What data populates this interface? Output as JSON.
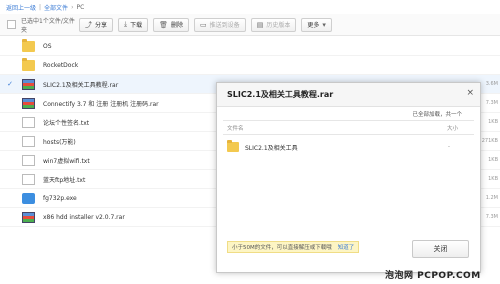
{
  "breadcrumb": {
    "items": [
      "返回上一级",
      "全部文件"
    ],
    "separator": "|",
    "current": "PC"
  },
  "toolbar": {
    "selection_text": "已选中1个文件/文件夹",
    "share_label": "分享",
    "download_label": "下载",
    "delete_label": "删除",
    "push_label": "推送到设备",
    "history_label": "历史版本",
    "more_label": "更多"
  },
  "files": [
    {
      "name": "OS",
      "type": "folder",
      "size": "",
      "selected": false
    },
    {
      "name": "RocketDock",
      "type": "folder",
      "size": "",
      "selected": false
    },
    {
      "name": "SLIC2.1及相关工具教程.rar",
      "type": "rar",
      "size": "3.6M",
      "selected": true
    },
    {
      "name": "Connectify 3.7 和 注册 注册机 注册码.rar",
      "type": "rar",
      "size": "7.3M",
      "selected": false
    },
    {
      "name": "论坛个性签名.txt",
      "type": "txt",
      "size": "1KB",
      "selected": false
    },
    {
      "name": "hosts(万能)",
      "type": "txt",
      "size": "271KB",
      "selected": false
    },
    {
      "name": "win7虚拟wifi.txt",
      "type": "txt",
      "size": "1KB",
      "selected": false
    },
    {
      "name": "蓝天ftp地址.txt",
      "type": "txt",
      "size": "1KB",
      "selected": false
    },
    {
      "name": "fg732p.exe",
      "type": "exe",
      "size": "1.2M",
      "selected": false
    },
    {
      "name": "x86 hdd installer v2.0.7.rar",
      "type": "rar",
      "size": "7.3M",
      "selected": false
    }
  ],
  "dialog": {
    "title": "SLIC2.1及相关工具教程.rar",
    "close_glyph": "×",
    "status": "已全部加载，共一个",
    "col_name": "文件名",
    "col_size": "大小",
    "entry_name": "SLIC2.1及相关工具",
    "entry_size": "-",
    "tip": "小于50M的文件，可以直接解压或下载哦",
    "tip_link": "知道了",
    "close_button": "关闭"
  },
  "watermark": "泡泡网 PCPOP.COM",
  "icons": {
    "check": "✓",
    "share": "share-icon",
    "download": "download-icon",
    "delete": "trash-icon"
  }
}
